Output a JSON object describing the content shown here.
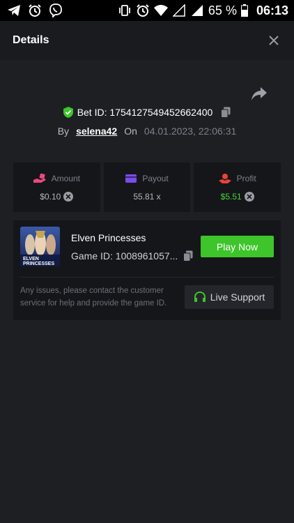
{
  "status_bar": {
    "icons_left": [
      "telegram-icon",
      "alarm-icon",
      "viber-icon"
    ],
    "icons_right": [
      "vibrate-icon",
      "alarm-icon",
      "wifi-icon",
      "signal-empty-icon",
      "signal-icon"
    ],
    "battery_percent": "65 %",
    "time": "06:13"
  },
  "header": {
    "title": "Details",
    "close_icon": "close-icon"
  },
  "bet": {
    "id_text": "Bet ID: 1754127549452662400",
    "by_label": "By",
    "username": "selena42",
    "on_label": "On",
    "date": "04.01.2023, 22:06:31"
  },
  "stats": [
    {
      "label": "Amount",
      "value": "$0.10",
      "icon": "amount-icon",
      "color": "#e84a7c"
    },
    {
      "label": "Payout",
      "value": "55.81 x",
      "icon": "payout-card-icon",
      "color": "#7b4de8"
    },
    {
      "label": "Profit",
      "value": "$5.51",
      "icon": "profit-icon",
      "color": "#e8433a"
    }
  ],
  "game": {
    "name": "Elven Princesses",
    "game_id": "Game ID: 1008961057...",
    "thumb_text_line1": "ELVEN",
    "thumb_text_line2": "PRINCESSES",
    "play_label": "Play Now",
    "support_text": "Any issues, please contact the customer service for help and provide the game ID.",
    "support_label": "Live Support"
  },
  "colors": {
    "accent_green": "#3ec52b",
    "profit_green": "#4dd43a",
    "background": "#1e1f23",
    "panel": "#15161a"
  }
}
